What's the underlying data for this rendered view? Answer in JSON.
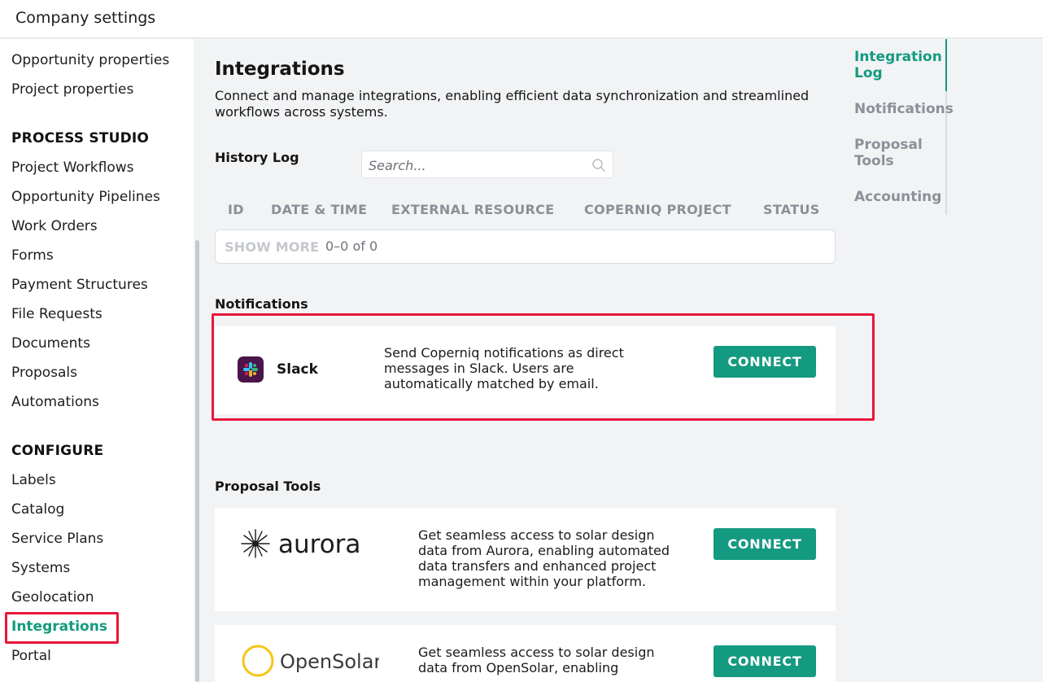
{
  "header": {
    "title": "Company settings"
  },
  "sidebar": {
    "items_top": [
      "Opportunity properties",
      "Project properties"
    ],
    "process_studio": {
      "title": "PROCESS STUDIO",
      "items": [
        "Project Workflows",
        "Opportunity Pipelines",
        "Work Orders",
        "Forms",
        "Payment Structures",
        "File Requests",
        "Documents",
        "Proposals",
        "Automations"
      ]
    },
    "configure": {
      "title": "CONFIGURE",
      "items": [
        "Labels",
        "Catalog",
        "Service Plans",
        "Systems",
        "Geolocation",
        "Integrations",
        "Portal"
      ]
    },
    "active_item": "Integrations"
  },
  "main": {
    "title": "Integrations",
    "subtitle": "Connect and manage integrations, enabling efficient data synchronization and streamlined workflows across systems.",
    "history": {
      "label": "History Log",
      "search_placeholder": "Search...",
      "columns": [
        "ID",
        "DATE & TIME",
        "EXTERNAL RESOURCE",
        "COPERNIQ PROJECT",
        "STATUS"
      ],
      "show_more": "SHOW MORE",
      "count": "0–0 of 0"
    },
    "notifications": {
      "title": "Notifications",
      "cards": [
        {
          "name": "Slack",
          "desc_lines": [
            "Send Coperniq notifications as direct",
            "messages in Slack. Users are",
            "automatically matched by email."
          ],
          "button": "CONNECT"
        }
      ]
    },
    "proposal_tools": {
      "title": "Proposal Tools",
      "cards": [
        {
          "name": "aurora",
          "desc_lines": [
            "Get seamless access to solar design",
            "data from Aurora, enabling automated",
            "data transfers and enhanced project",
            "management within your platform."
          ],
          "button": "CONNECT"
        },
        {
          "name": "OpenSolar",
          "desc_lines": [
            "Get seamless access to solar design",
            "data from OpenSolar, enabling"
          ],
          "button": "CONNECT"
        }
      ]
    }
  },
  "right_nav": {
    "items": [
      "Integration Log",
      "Notifications",
      "Proposal Tools",
      "Accounting"
    ],
    "active": "Integration Log"
  },
  "colors": {
    "accent": "#149a80",
    "highlight": "#e8173a",
    "slack_bg": "#4a154b"
  }
}
